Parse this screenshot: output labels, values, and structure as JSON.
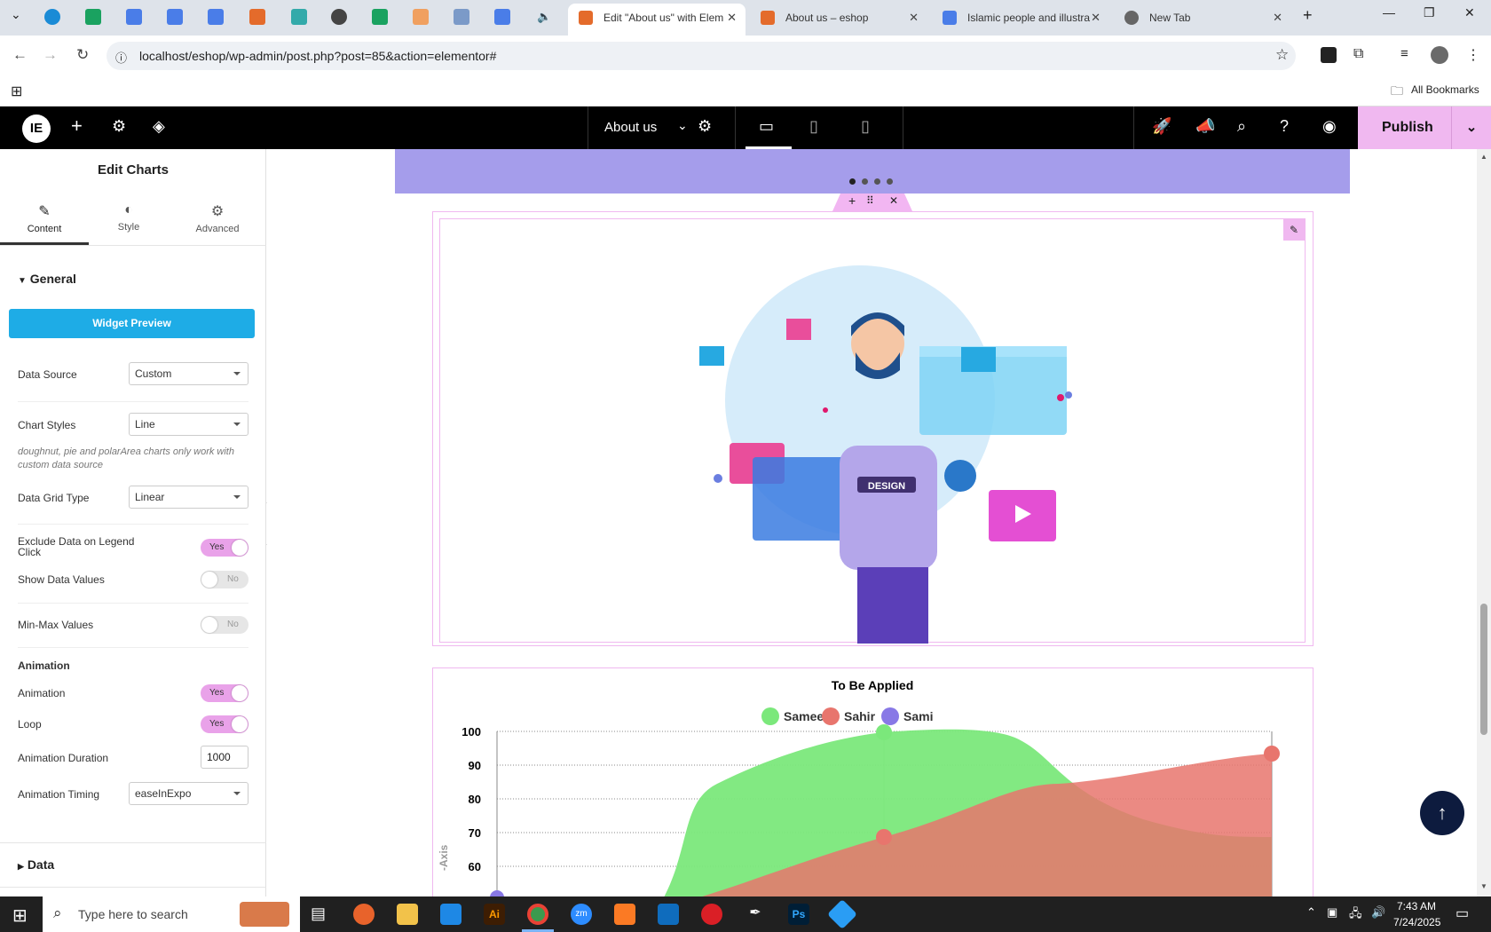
{
  "browser": {
    "tabs": [
      {
        "label": "Edit \"About us\" with Elem",
        "active": true
      },
      {
        "label": "About us – eshop",
        "active": false
      },
      {
        "label": "Islamic people and illustra",
        "active": false
      },
      {
        "label": "New Tab",
        "active": false
      }
    ],
    "url": "localhost/eshop/wp-admin/post.php?post=85&action=elementor#",
    "bookmarks_label": "All Bookmarks"
  },
  "elementor": {
    "page_title": "About us",
    "publish_label": "Publish"
  },
  "panel": {
    "title": "Edit Charts",
    "tabs": [
      "Content",
      "Style",
      "Advanced"
    ],
    "section_general": "General",
    "widget_preview": "Widget Preview",
    "fields": {
      "data_source": {
        "label": "Data Source",
        "value": "Custom"
      },
      "chart_styles": {
        "label": "Chart Styles",
        "value": "Line"
      },
      "note": "doughnut, pie and polarArea charts only work with custom data source",
      "data_grid_type": {
        "label": "Data Grid Type",
        "value": "Linear"
      },
      "exclude_data": {
        "label": "Exclude Data on Legend Click",
        "value": "Yes"
      },
      "show_values": {
        "label": "Show Data Values",
        "value": "No"
      },
      "min_max": {
        "label": "Min-Max Values",
        "value": "No"
      }
    },
    "animation_heading": "Animation",
    "animation": {
      "label": "Animation",
      "value": "Yes"
    },
    "loop": {
      "label": "Loop",
      "value": "Yes"
    },
    "duration": {
      "label": "Animation Duration",
      "value": "1000"
    },
    "timing": {
      "label": "Animation Timing",
      "value": "easeInExpo"
    },
    "section_data": "Data"
  },
  "illustration": {
    "shirt_text": "DESIGN"
  },
  "chart_data": {
    "type": "area",
    "title": "To Be Applied",
    "legend": [
      "Sameer",
      "Sahir",
      "Sami"
    ],
    "colors": [
      "#7be87b",
      "#e8756d",
      "#8878e6"
    ],
    "yticks": [
      100,
      90,
      80,
      70,
      60
    ],
    "ylabel_partial": "-Axis"
  },
  "taskbar": {
    "search_placeholder": "Type here to search",
    "time": "7:43 AM",
    "date": "7/24/2025"
  }
}
